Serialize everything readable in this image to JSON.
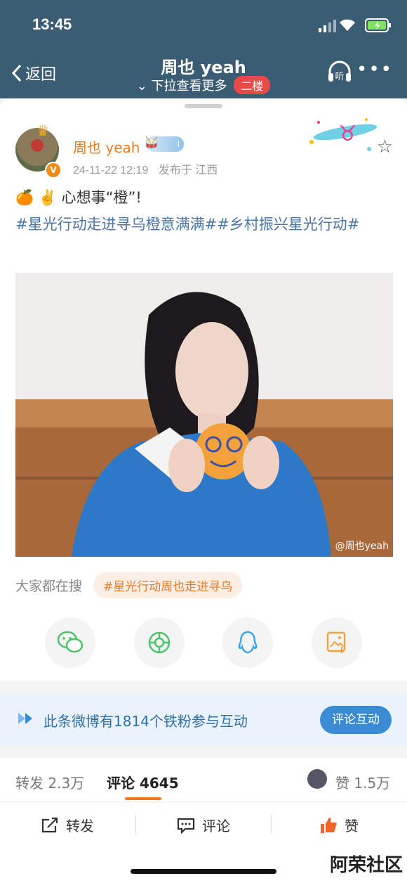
{
  "status": {
    "time": "13:45"
  },
  "nav": {
    "back_label": "返回",
    "title": "周也 yeah",
    "subtitle": "下拉查看更多",
    "floor_badge": "二楼",
    "listen_label": "听"
  },
  "post": {
    "author": "周也 yeah",
    "level": "I",
    "timestamp": "24-11-22 12:19",
    "location": "发布于 江西",
    "text_main": "🍊 ✌️ 心想事“橙”!",
    "hashtags": "#星光行动走进寻乌橙意满满##乡村振兴星光行动#",
    "watermark": "@周也yeah"
  },
  "search": {
    "label": "大家都在搜",
    "chip": "#星光行动周也走进寻乌"
  },
  "share_icons": [
    "wechat-icon",
    "moments-icon",
    "qq-icon",
    "save-image-icon"
  ],
  "fans_banner": {
    "text": "此条微博有1814个铁粉参与互动",
    "button": "评论互动"
  },
  "counts": {
    "repost_label": "转发",
    "repost_count": "2.3万",
    "comment_label": "评论",
    "comment_count": "4645",
    "like_label": "赞",
    "like_count": "1.5万"
  },
  "actions": {
    "repost": "转发",
    "comment": "评论",
    "like": "赞"
  },
  "corner_watermark": "阿荣社区",
  "colors": {
    "nav_bg": "#3b5d74",
    "accent_orange": "#f07b1c",
    "link_blue": "#4a76a8",
    "fans_blue": "#3a8ad4"
  }
}
